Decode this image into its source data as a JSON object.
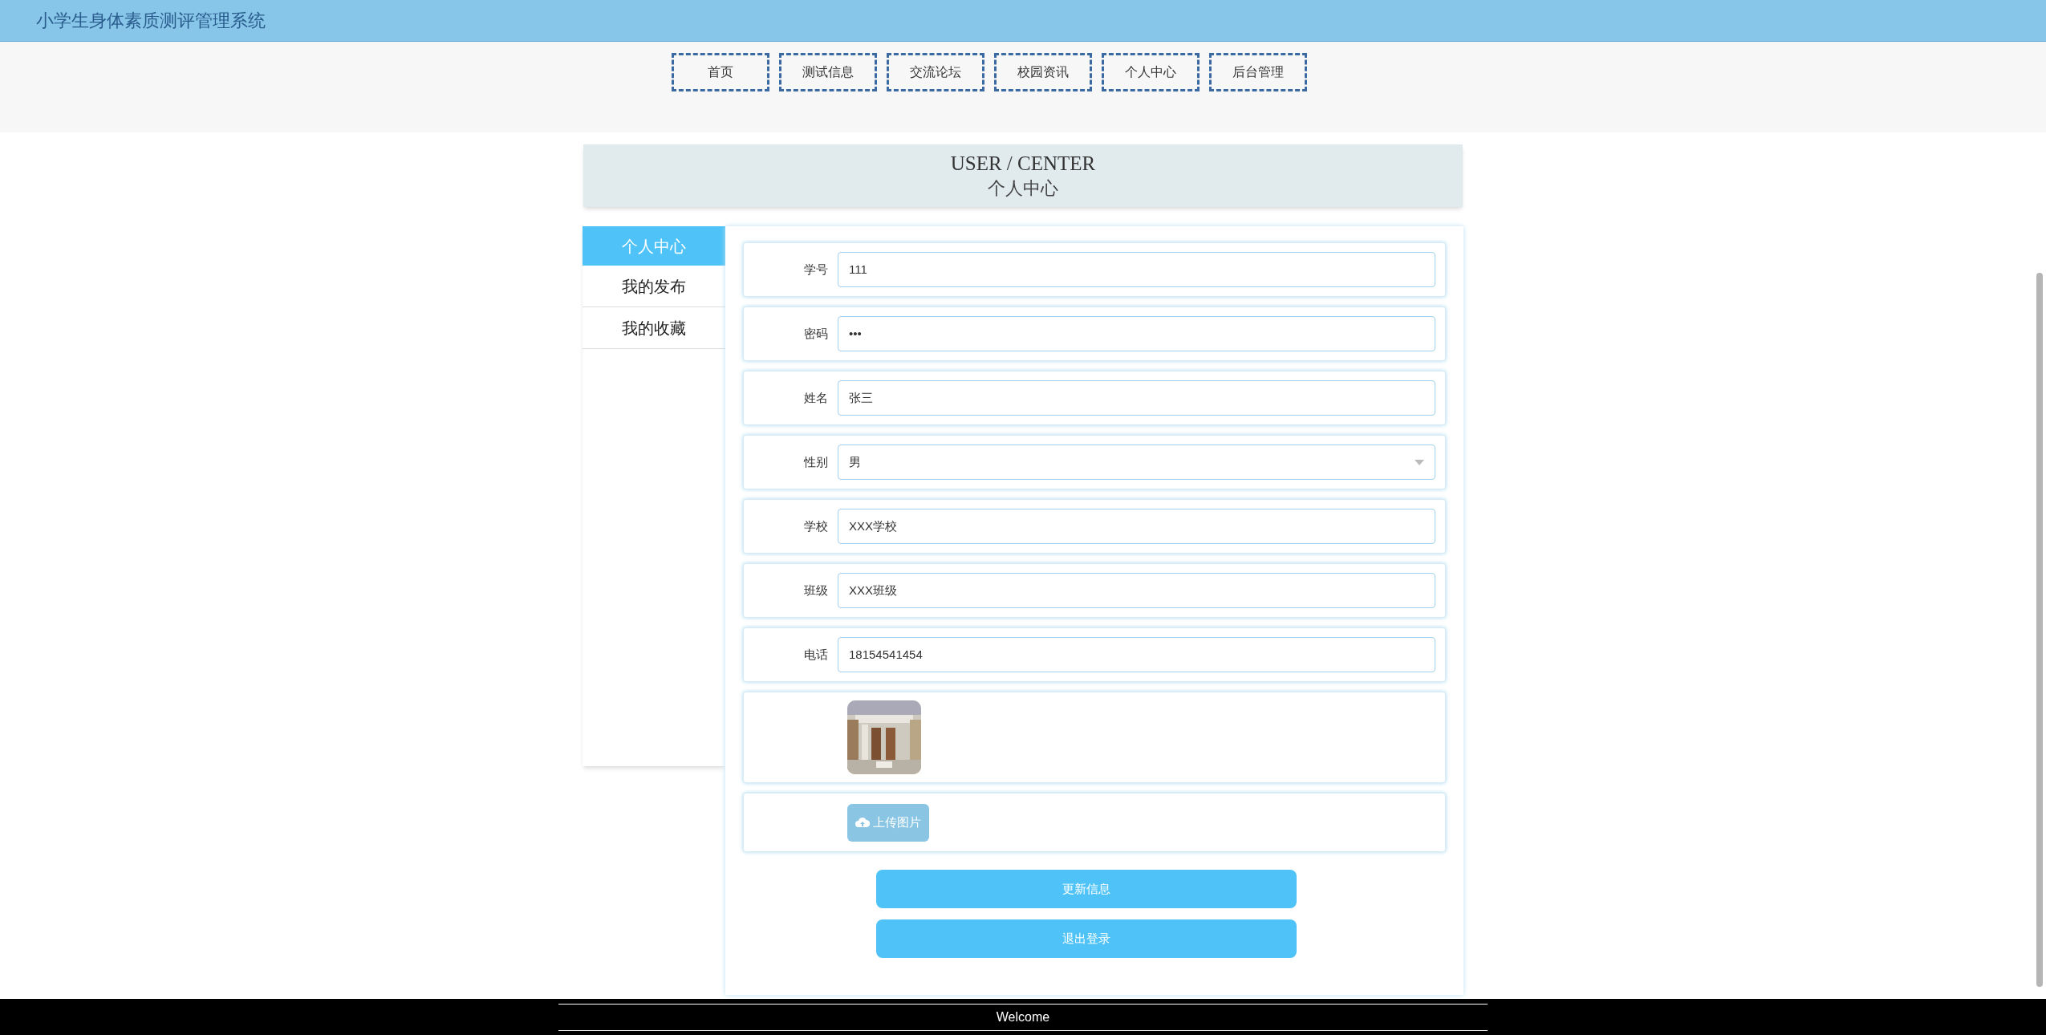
{
  "site_title": "小学生身体素质测评管理系统",
  "nav": [
    "首页",
    "测试信息",
    "交流论坛",
    "校园资讯",
    "个人中心",
    "后台管理"
  ],
  "page_heading": {
    "title": "USER / CENTER",
    "subtitle": "个人中心"
  },
  "sidebar": [
    {
      "label": "个人中心",
      "selected": true
    },
    {
      "label": "我的发布",
      "selected": false
    },
    {
      "label": "我的收藏",
      "selected": false
    }
  ],
  "form": [
    {
      "kind": "text",
      "label": "学号",
      "value": "111"
    },
    {
      "kind": "password",
      "label": "密码",
      "value": "•••"
    },
    {
      "kind": "text",
      "label": "姓名",
      "value": "张三"
    },
    {
      "kind": "select",
      "label": "性别",
      "value": "男"
    },
    {
      "kind": "text",
      "label": "学校",
      "value": "XXX学校"
    },
    {
      "kind": "text",
      "label": "班级",
      "value": "XXX班级"
    },
    {
      "kind": "text",
      "label": "电话",
      "value": "18154541454"
    },
    {
      "kind": "picture"
    },
    {
      "kind": "upload",
      "button": "上传图片"
    }
  ],
  "actions": [
    "更新信息",
    "退出登录"
  ],
  "footer": "Welcome"
}
